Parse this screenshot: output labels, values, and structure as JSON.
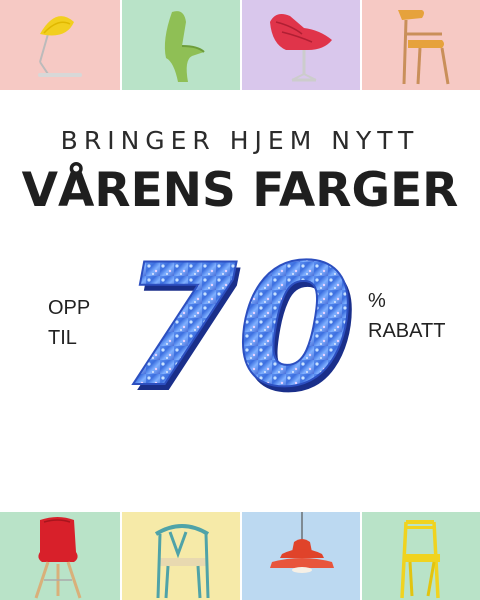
{
  "tiles_top": [
    {
      "name": "yellow-lamp-tile",
      "bg": "#f6c9c4",
      "icon": "table-lamp-icon"
    },
    {
      "name": "green-chair-tile",
      "bg": "#b9e3c8",
      "icon": "panton-chair-icon"
    },
    {
      "name": "red-lounge-chair-tile",
      "bg": "#d9c7ec",
      "icon": "lounge-chair-icon"
    },
    {
      "name": "orange-chair-tile",
      "bg": "#f6c9c4",
      "icon": "wooden-armchair-icon"
    }
  ],
  "tiles_bottom": [
    {
      "name": "red-eames-chair-tile",
      "bg": "#b9e3c8",
      "icon": "eames-chair-icon"
    },
    {
      "name": "wishbone-chair-tile",
      "bg": "#f6eaa8",
      "icon": "wishbone-chair-icon"
    },
    {
      "name": "pendant-lamp-tile",
      "bg": "#bcd9f1",
      "icon": "pendant-lamp-icon"
    },
    {
      "name": "yellow-metal-chair-tile",
      "bg": "#b9e3c8",
      "icon": "metal-chair-icon"
    }
  ],
  "headline": {
    "sub": "BRINGER HJEM NYTT",
    "main": "VÅRENS FARGER"
  },
  "offer": {
    "left_line1": "OPP",
    "left_line2": "TIL",
    "number": "70",
    "right_line1": "%",
    "right_line2": "RABATT"
  },
  "colors": {
    "number_fill": "#4a7fe0",
    "number_shadow": "#1a2f8a"
  }
}
